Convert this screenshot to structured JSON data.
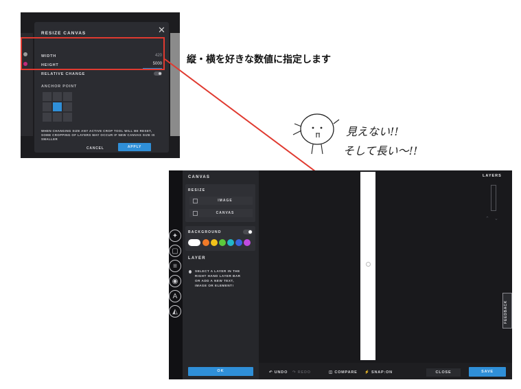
{
  "dialog": {
    "title": "RESIZE CANVAS",
    "close_icon": "close-icon",
    "width_label": "WIDTH",
    "width_value": "420",
    "height_label": "HEIGHT",
    "height_value": "5000",
    "relative_label": "RELATIVE CHANGE",
    "anchor_label": "ANCHOR POINT",
    "note": "WHEN CHANGING SIZE ANY ACTIVE CROP TOOL WILL BE RESET, SOME CROPPING OF LAYERS MAY OCCUR IF NEW CANVAS SIZE IS SMALLER",
    "cancel_label": "CANCEL",
    "apply_label": "APPLY"
  },
  "annotation": {
    "caption": "縦・横を好きな数値に指定します",
    "hand_line1": "見えない!!",
    "hand_line2": "そして長い〜!!"
  },
  "editor": {
    "panel_title": "CANVAS",
    "resize_label": "RESIZE",
    "image_button": "IMAGE",
    "canvas_button": "CANVAS",
    "background_label": "BACKGROUND",
    "layer_label": "LAYER",
    "layer_note": "SELECT A LAYER IN THE RIGHT HAND LAYER BAR OR ADD A NEW TEXT, IMAGE OR ELEMENT!",
    "ok_label": "OK",
    "undo_label": "UNDO",
    "redo_label": "REDO",
    "compare_label": "COMPARE",
    "snap_label": "SNAP:ON",
    "close_label": "CLOSE",
    "save_label": "SAVE",
    "layers_label": "LAYERS",
    "feedback_label": "FEEDBACK",
    "swatch_colors": [
      "#ffffff",
      "#f07a28",
      "#f2c21b",
      "#5cc93c",
      "#22b7c9",
      "#3a64e0",
      "#a03ae0",
      "#e03aa8"
    ]
  },
  "colors": {
    "accent": "#2f8fd8",
    "highlight": "#e03a30"
  }
}
